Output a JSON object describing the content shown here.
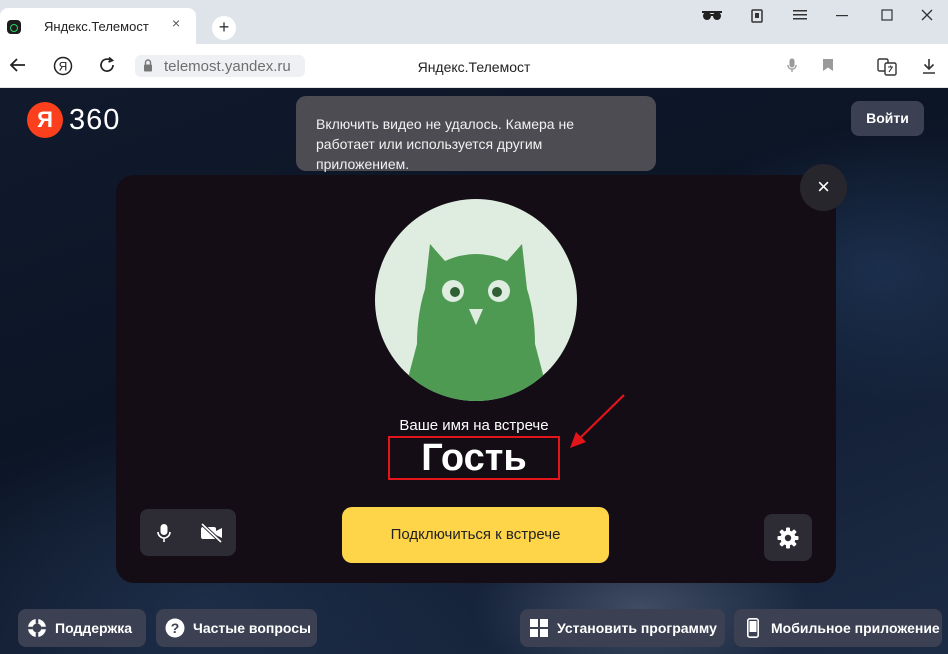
{
  "browser": {
    "tab_title": "Яндекс.Телемост",
    "tab_close": "×",
    "new_tab": "+",
    "url": "telemost.yandex.ru",
    "page_title": "Яндекс.Телемост",
    "icons": [
      "incognito-icon",
      "collections-icon",
      "menu-icon",
      "minimize-icon",
      "maximize-icon",
      "close-window-icon"
    ]
  },
  "header": {
    "logo_letter": "Я",
    "logo_text": "360",
    "login_label": "Войти"
  },
  "toast": {
    "message": "Включить видео не удалось. Камера не работает или используется другим приложением."
  },
  "card": {
    "close_label": "×",
    "name_caption": "Ваше имя на встрече",
    "name_value": "Гость",
    "join_label": "Подключиться к встрече"
  },
  "footer": {
    "support_label": "Поддержка",
    "faq_label": "Частые вопросы",
    "install_label": "Установить программу",
    "mobile_label": "Мобильное приложение"
  },
  "colors": {
    "accent_yellow": "#fed549",
    "annotation_red": "#e4141b",
    "logo_red": "#fc3f1d",
    "avatar_green": "#4e9a53"
  }
}
